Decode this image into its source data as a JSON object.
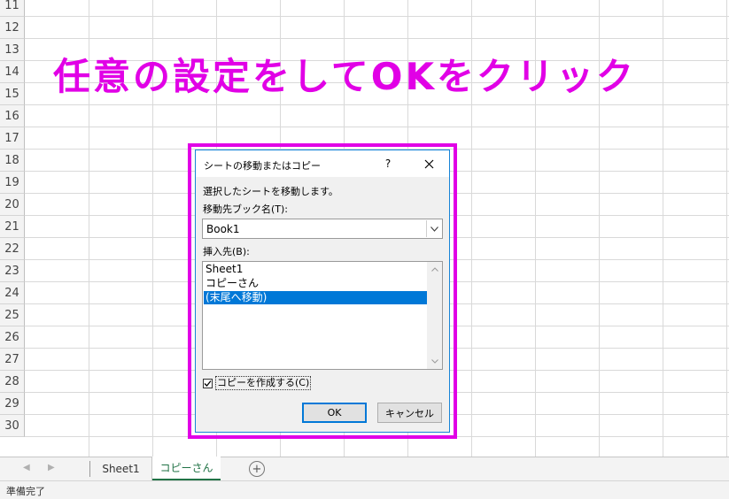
{
  "spreadsheet": {
    "row_numbers": [
      "11",
      "12",
      "13",
      "14",
      "15",
      "16",
      "17",
      "18",
      "19",
      "20",
      "21",
      "22",
      "23",
      "24",
      "25",
      "26",
      "27",
      "28",
      "29",
      "30"
    ]
  },
  "annotation": {
    "headline": "任意の設定をしてOKをクリック",
    "color": "#e100e6"
  },
  "dialog": {
    "title": "シートの移動またはコピー",
    "help_label": "?",
    "close_icon": "close-icon",
    "instruction": "選択したシートを移動します。",
    "destination_book_label": "移動先ブック名(T):",
    "destination_book_value": "Book1",
    "insert_before_label": "挿入先(B):",
    "insert_before_items": [
      {
        "label": "Sheet1",
        "selected": false
      },
      {
        "label": "コピーさん",
        "selected": false
      },
      {
        "label": "(末尾へ移動)",
        "selected": true
      }
    ],
    "create_copy_label": "コピーを作成する(C)",
    "create_copy_checked": true,
    "ok_label": "OK",
    "cancel_label": "キャンセル",
    "accent_color": "#0078d7"
  },
  "sheet_tabs": {
    "tabs": [
      {
        "label": "Sheet1",
        "active": false
      },
      {
        "label": "コピーさん",
        "active": true
      }
    ],
    "add_sheet_symbol": "+",
    "active_color": "#217346"
  },
  "status_bar": {
    "text": "準備完了"
  }
}
